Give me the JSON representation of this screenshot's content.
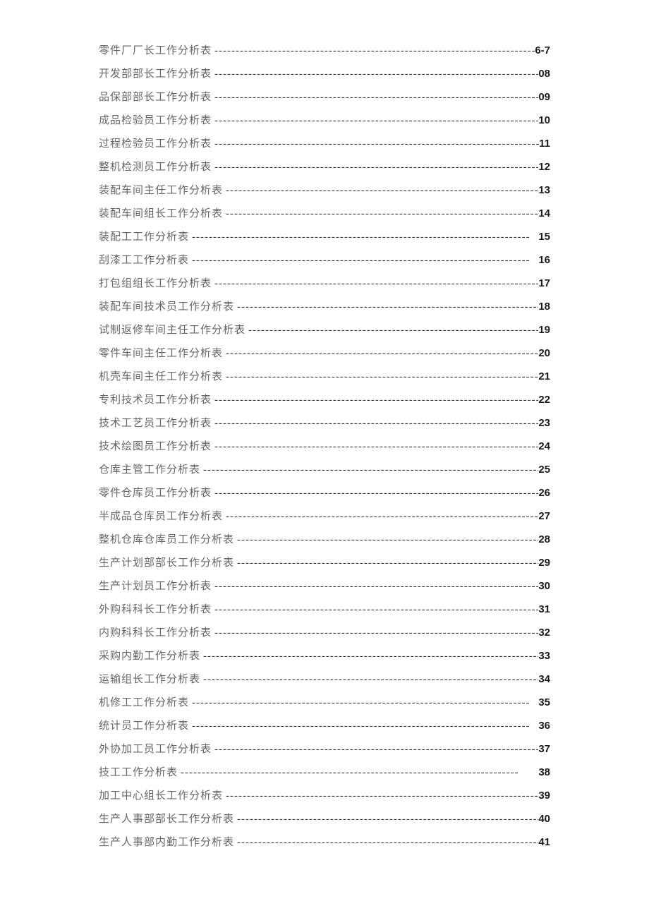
{
  "toc": {
    "entries": [
      {
        "title": "零件厂厂长工作分析表",
        "page": "6-7"
      },
      {
        "title": "开发部部长工作分析表",
        "page": "08"
      },
      {
        "title": "品保部部长工作分析表",
        "page": "09"
      },
      {
        "title": "成品检验员工作分析表",
        "page": "10"
      },
      {
        "title": "过程检验员工作分析表",
        "page": "11"
      },
      {
        "title": "整机检测员工作分析表",
        "page": "12"
      },
      {
        "title": "装配车间主任工作分析表",
        "page": "13"
      },
      {
        "title": "装配车间组长工作分析表",
        "page": "14"
      },
      {
        "title": "装配工工作分析表",
        "page": "15"
      },
      {
        "title": "刮漆工工作分析表",
        "page": "16"
      },
      {
        "title": "打包组组长工作分析表",
        "page": "17"
      },
      {
        "title": "装配车间技术员工作分析表",
        "page": "18"
      },
      {
        "title": "试制返修车间主任工作分析表",
        "page": "19"
      },
      {
        "title": "零件车间主任工作分析表",
        "page": "20"
      },
      {
        "title": "机壳车间主任工作分析表",
        "page": "21"
      },
      {
        "title": "专利技术员工作分析表",
        "page": "22"
      },
      {
        "title": "技术工艺员工作分析表",
        "page": "23"
      },
      {
        "title": "技术绘图员工作分析表",
        "page": "24"
      },
      {
        "title": "仓库主管工作分析表",
        "page": "25"
      },
      {
        "title": "零件仓库员工作分析表",
        "page": "26"
      },
      {
        "title": "半成品仓库员工作分析表",
        "page": "27"
      },
      {
        "title": "整机仓库仓库员工作分析表",
        "page": "28"
      },
      {
        "title": "生产计划部部长工作分析表",
        "page": "29"
      },
      {
        "title": "生产计划员工作分析表",
        "page": "30"
      },
      {
        "title": "外购科科长工作分析表",
        "page": "31"
      },
      {
        "title": "内购科科长工作分析表",
        "page": "32"
      },
      {
        "title": "采购内勤工作分析表",
        "page": "33"
      },
      {
        "title": "运输组长工作分析表",
        "page": "34"
      },
      {
        "title": "机修工工作分析表",
        "page": "35"
      },
      {
        "title": "统计员工作分析表",
        "page": "36"
      },
      {
        "title": "外协加工员工作分析表",
        "page": "37"
      },
      {
        "title": "技工工作分析表",
        "page": "38"
      },
      {
        "title": "加工中心组长工作分析表",
        "page": "39"
      },
      {
        "title": "生产人事部部长工作分析表",
        "page": "40"
      },
      {
        "title": "生产人事部内勤工作分析表",
        "page": "41"
      }
    ]
  }
}
